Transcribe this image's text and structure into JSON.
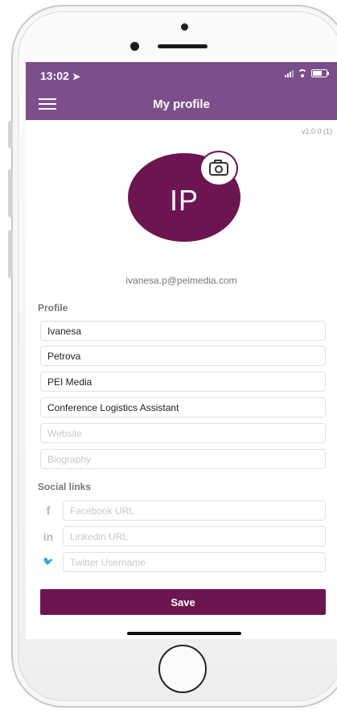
{
  "status_bar": {
    "time": "13:02",
    "location_symbol": "➤"
  },
  "nav": {
    "title": "My profile"
  },
  "version": "v1.0.0 (1)",
  "avatar": {
    "initials": "IP",
    "color": "#6d1550"
  },
  "email": "ivanesa.p@peimedia.com",
  "profile": {
    "section_label": "Profile",
    "first_name": "Ivanesa",
    "last_name": "Petrova",
    "company": "PEI Media",
    "job_title": "Conference Logistics Assistant",
    "website_placeholder": "Website",
    "biography_placeholder": "Biography"
  },
  "social": {
    "section_label": "Social links",
    "facebook": {
      "icon_glyph": "f",
      "placeholder": "Facebook URL"
    },
    "linkedin": {
      "icon_glyph": "in",
      "placeholder": "Linkedin URL"
    },
    "twitter": {
      "icon_glyph": "🐦",
      "placeholder": "Twitter Username"
    }
  },
  "save_label": "Save",
  "colors": {
    "header": "#7b4f8b",
    "accent": "#6d1550"
  }
}
